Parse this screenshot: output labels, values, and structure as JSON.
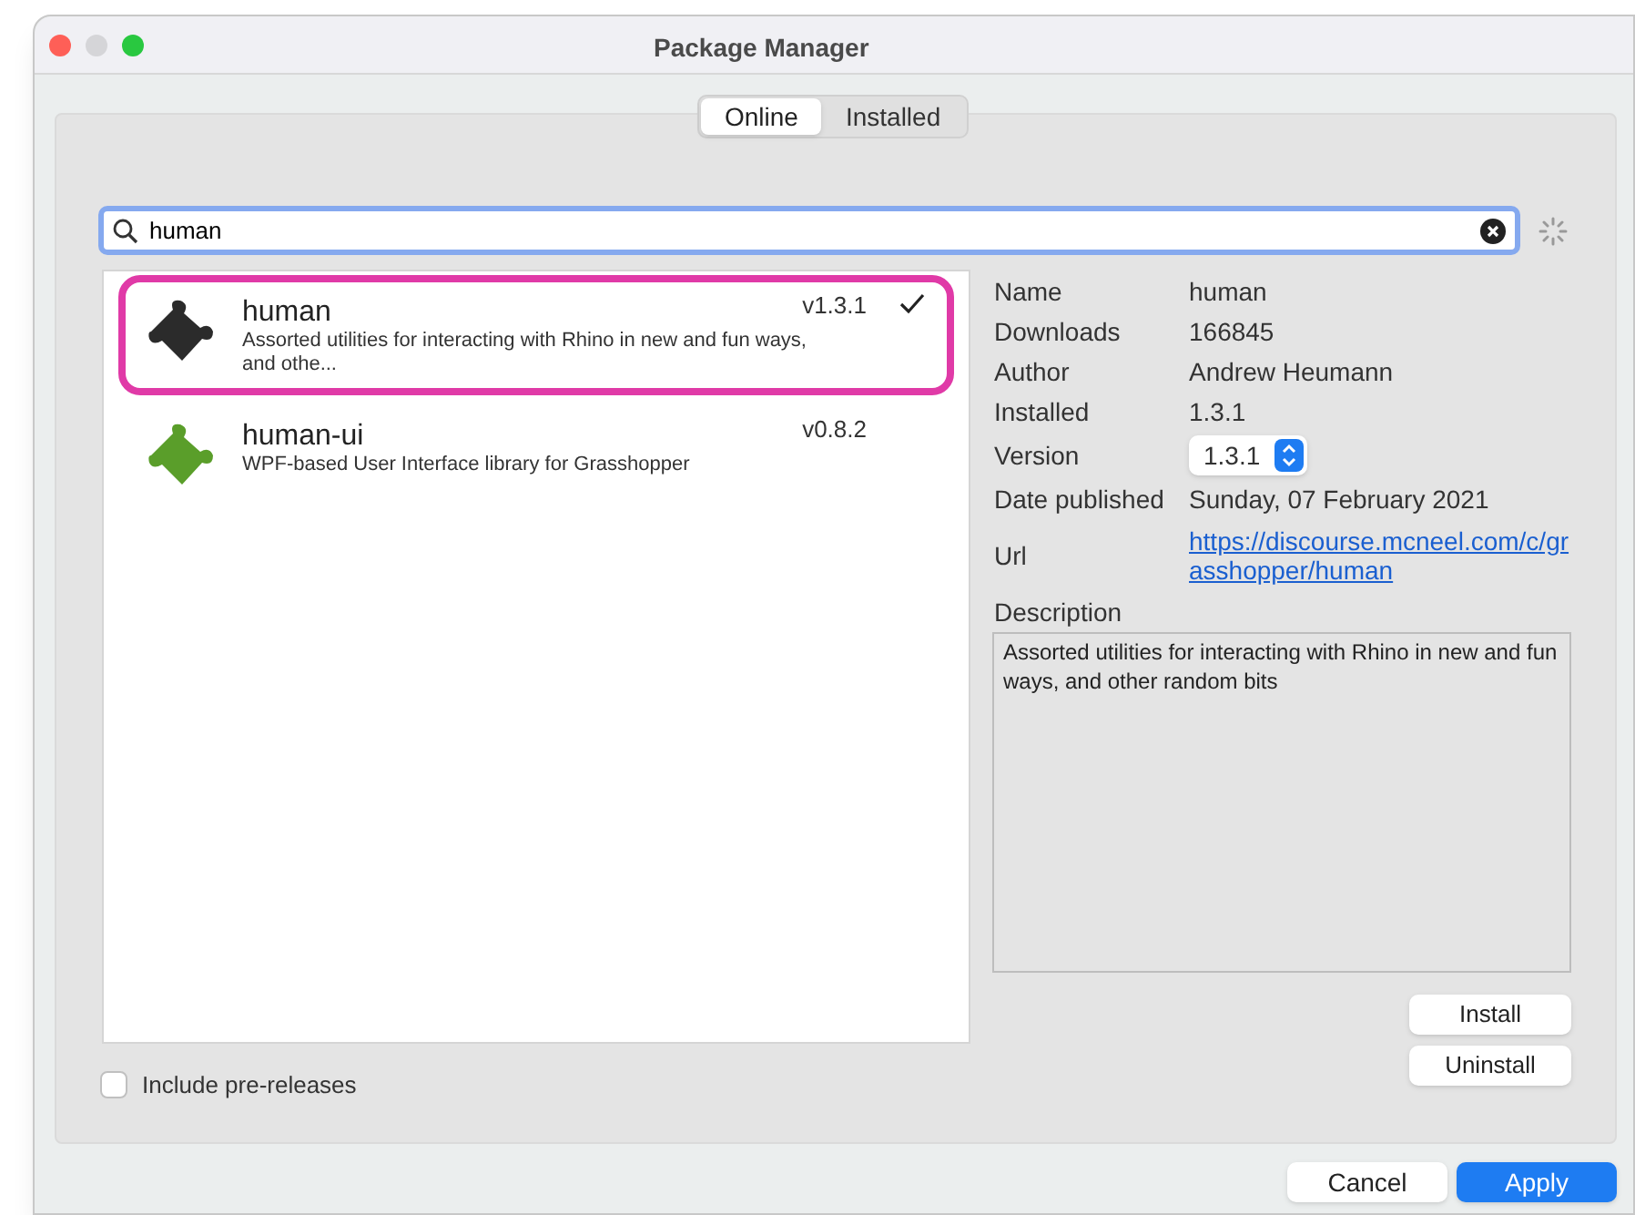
{
  "window": {
    "title": "Package Manager"
  },
  "tabs": [
    {
      "label": "Online",
      "selected": true
    },
    {
      "label": "Installed",
      "selected": false
    }
  ],
  "search": {
    "value": "human"
  },
  "packages": [
    {
      "name": "human",
      "description": "Assorted utilities for interacting with Rhino in new and fun ways, and othe...",
      "version": "v1.3.1",
      "installed": true,
      "highlighted": true,
      "color": "#2b2b2b"
    },
    {
      "name": "human-ui",
      "description": "WPF-based User Interface library for Grasshopper",
      "version": "v0.8.2",
      "installed": false,
      "highlighted": false,
      "color": "#5a9e2a"
    }
  ],
  "details": [
    {
      "kind": "text",
      "label": "Name",
      "value": "human"
    },
    {
      "kind": "text",
      "label": "Downloads",
      "value": "166845"
    },
    {
      "kind": "text",
      "label": "Author",
      "value": "Andrew Heumann"
    },
    {
      "kind": "text",
      "label": "Installed",
      "value": "1.3.1"
    },
    {
      "kind": "select",
      "label": "Version",
      "value": "1.3.1"
    },
    {
      "kind": "text",
      "label": "Date published",
      "value": "Sunday, 07 February 2021"
    },
    {
      "kind": "link",
      "label": "Url",
      "value": "https://discourse.mcneel.com/c/grasshopper/human"
    }
  ],
  "description": {
    "label": "Description",
    "value": "Assorted utilities for interacting with Rhino in new and fun ways, and other random bits"
  },
  "side_buttons": [
    "Install",
    "Uninstall"
  ],
  "include_prereleases": {
    "label": "Include pre-releases",
    "checked": false
  },
  "buttons": [
    {
      "label": "Cancel",
      "primary": false
    },
    {
      "label": "Apply",
      "primary": true
    }
  ]
}
